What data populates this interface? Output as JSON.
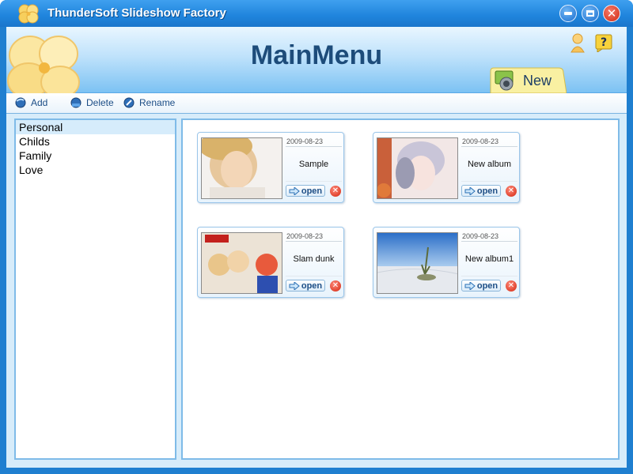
{
  "titlebar": {
    "title": "ThunderSoft Slideshow Factory",
    "icon": "clover-logo-icon"
  },
  "header": {
    "title": "MainMenu",
    "new_label": "New",
    "icons": [
      "user-icon",
      "help-icon"
    ]
  },
  "toolbar": {
    "add_label": "Add",
    "delete_label": "Delete",
    "rename_label": "Rename"
  },
  "categories": {
    "items": [
      "Personal",
      "Childs",
      "Family",
      "Love"
    ],
    "selected": "Personal"
  },
  "albums": [
    {
      "date": "2009-08-23",
      "name": "Sample",
      "open_label": "open"
    },
    {
      "date": "2009-08-23",
      "name": "New album",
      "open_label": "open"
    },
    {
      "date": "2009-08-23",
      "name": "Slam dunk",
      "open_label": "open"
    },
    {
      "date": "2009-08-23",
      "name": "New album1",
      "open_label": "open"
    }
  ],
  "colors": {
    "titlebar": "#1f84dc",
    "header_title": "#1d4c7a",
    "panel_border": "#7fbbe8",
    "selected_row": "#d6ecfb",
    "delete_red": "#d3250e"
  }
}
